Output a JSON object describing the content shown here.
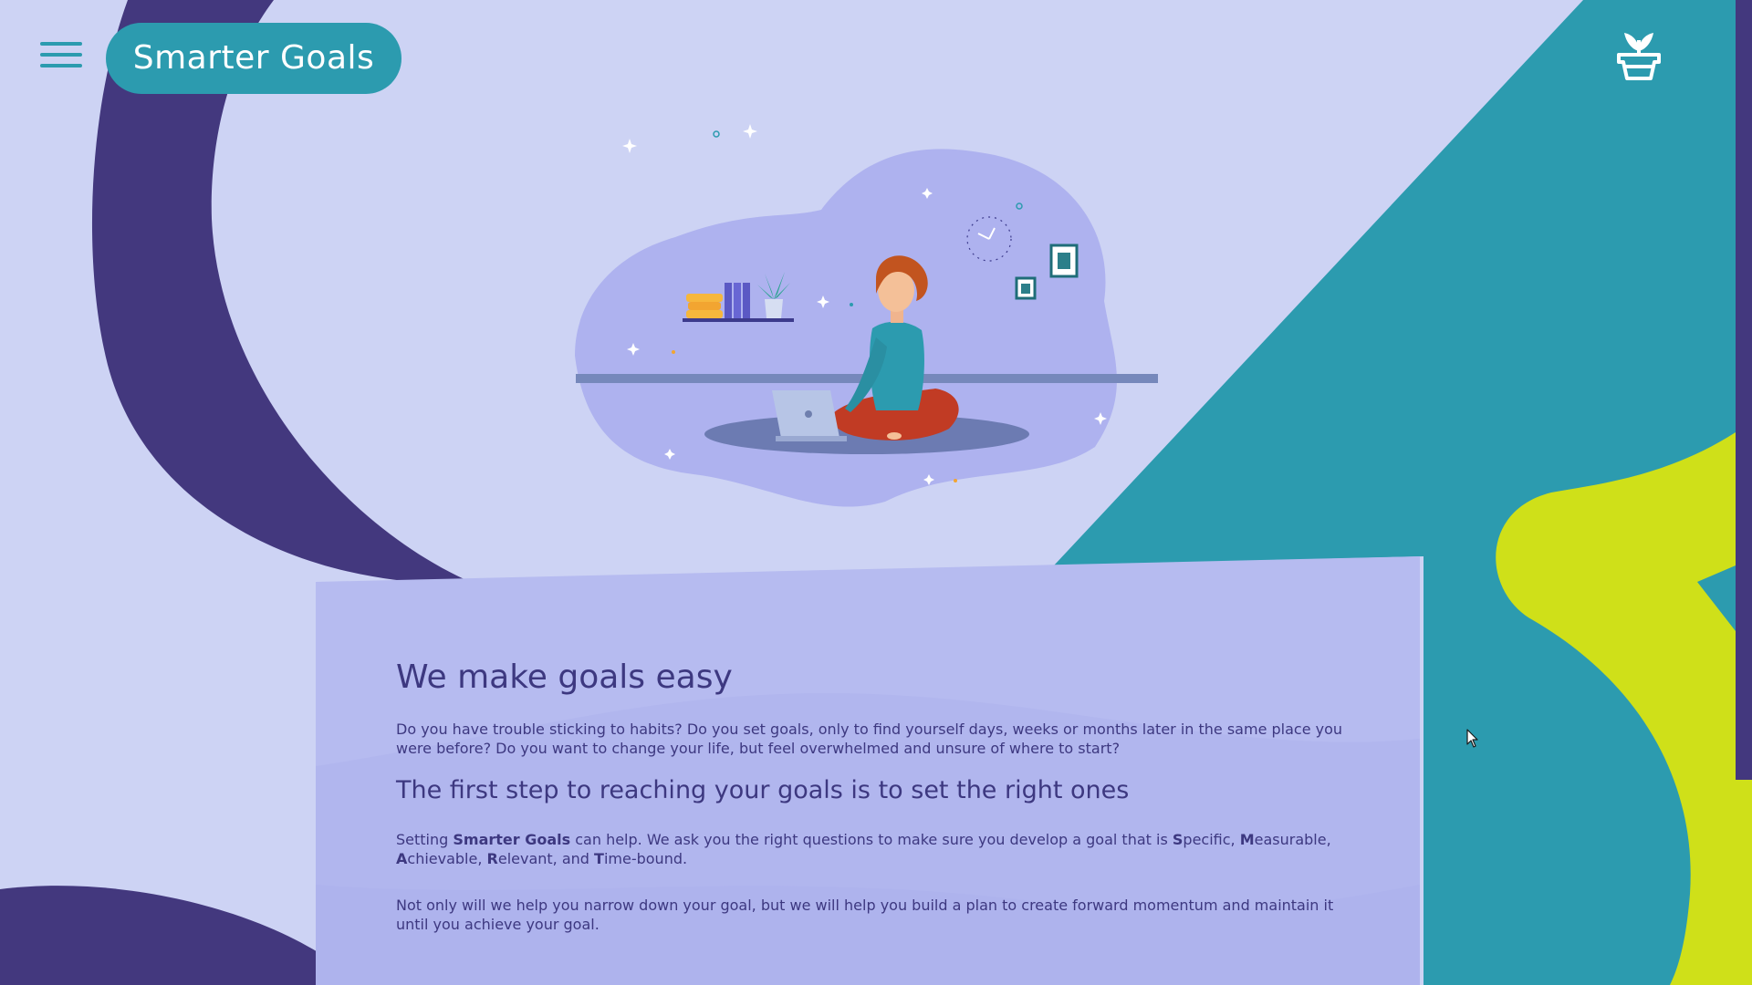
{
  "header": {
    "menu_icon": "hamburger-menu-icon",
    "brand": "Smarter Goals",
    "logo_icon": "plant-pot-icon"
  },
  "hero": {
    "illustration": "woman-with-laptop-illustration"
  },
  "content": {
    "heading": "We make goals easy",
    "intro": "Do you have trouble sticking to habits? Do you set goals, only to find yourself days, weeks or months later in the same place you were before? Do you want to change your life, but feel overwhelmed and unsure of where to start?",
    "subheading": "The first step to reaching your goals is to set the right ones",
    "setting": {
      "prefix": "Setting ",
      "brand": "Smarter Goals",
      "mid": " can help. We ask you the right questions to make sure you develop a goal that is ",
      "s_letter": "S",
      "s_rest": "pecific, ",
      "m_letter": "M",
      "m_rest": "easurable, ",
      "a_letter": "A",
      "a_rest": "chievable, ",
      "r_letter": "R",
      "r_rest": "elevant, and ",
      "t_letter": "T",
      "t_rest": "ime-bound."
    },
    "momentum": "Not only will we help you narrow down your goal, but we will help you build a plan to create forward momentum and maintain it until you achieve your goal."
  },
  "colors": {
    "background": "#cdd3f4",
    "purple": "#43387e",
    "teal": "#2c9baf",
    "lime": "#cfe019",
    "card": "#b6bbf0",
    "text": "#3d3880"
  }
}
